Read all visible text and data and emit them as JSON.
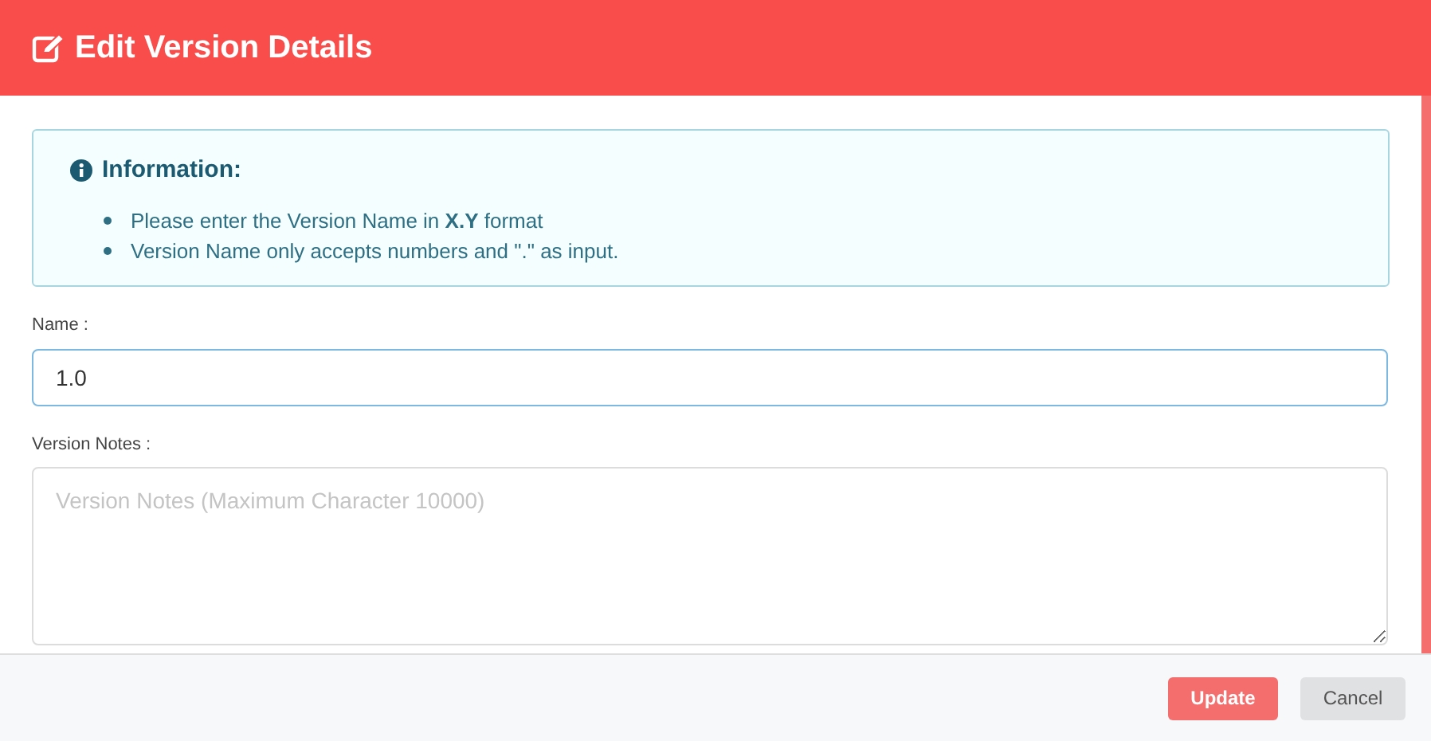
{
  "header": {
    "title": "Edit Version Details"
  },
  "info": {
    "title": "Information:",
    "items": [
      "Please enter the Version Name in **X.Y** format",
      "Version Name only accepts numbers and \".\" as input."
    ]
  },
  "name_field": {
    "label": "Name :",
    "value": "1.0",
    "focused": true
  },
  "notes_field": {
    "label": "Version Notes :",
    "placeholder": "Version Notes (Maximum Character 10000)"
  },
  "buttons": [
    {
      "label": "Update",
      "kind": "primary"
    },
    {
      "label": "Cancel",
      "kind": "secondary"
    }
  ]
}
